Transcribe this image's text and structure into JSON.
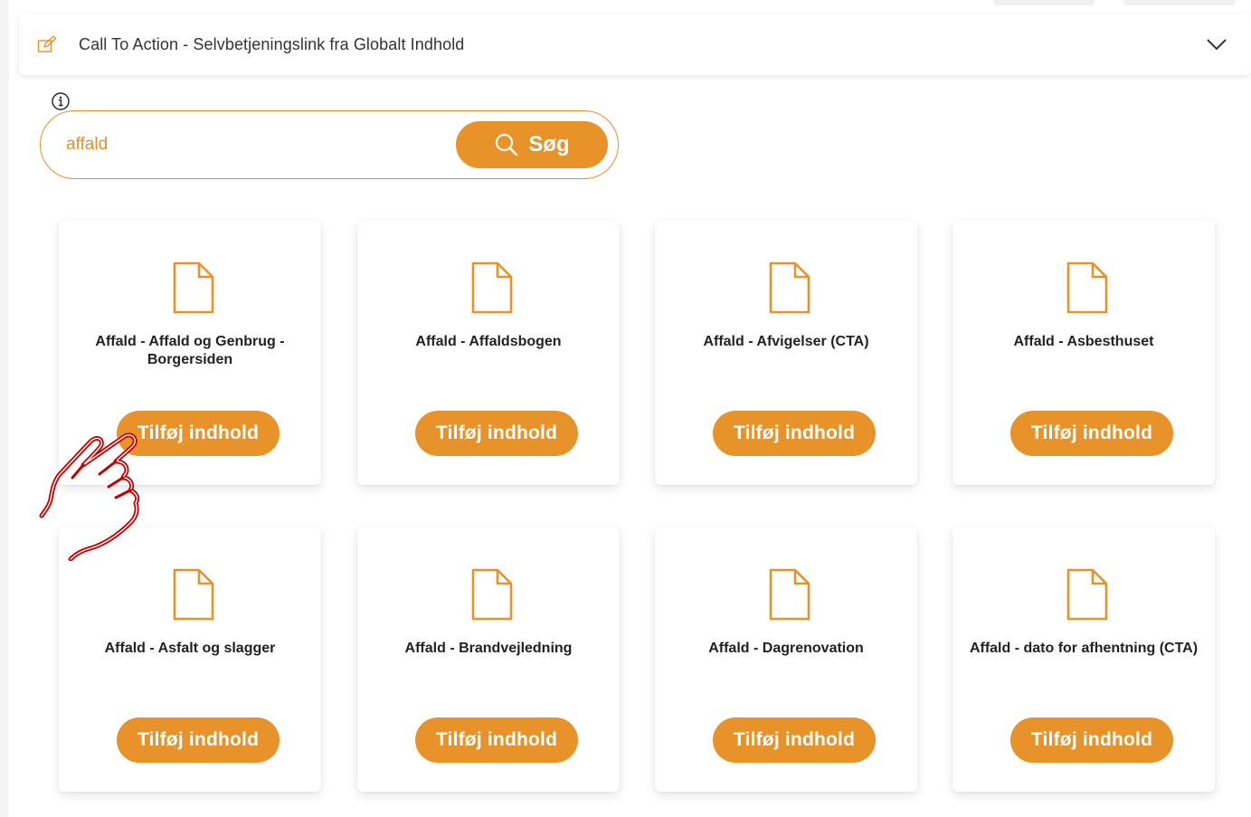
{
  "header": {
    "title": "Call To Action - Selvbetjeningslink fra Globalt Indhold",
    "edit_icon": "edit-icon",
    "toggle_icon": "chevron-down-icon"
  },
  "search": {
    "value": "affald",
    "button_label": "Søg",
    "info_icon": "info-icon"
  },
  "accent_color": "#e8922a",
  "cards": [
    {
      "title": "Affald - Affald og Genbrug - Borgersiden",
      "button": "Tilføj indhold"
    },
    {
      "title": "Affald - Affaldsbogen",
      "button": "Tilføj indhold"
    },
    {
      "title": "Affald - Afvigelser (CTA)",
      "button": "Tilføj indhold"
    },
    {
      "title": "Affald - Asbesthuset",
      "button": "Tilføj indhold"
    },
    {
      "title": "Affald - Asfalt og slagger",
      "button": "Tilføj indhold"
    },
    {
      "title": "Affald - Brandvejledning",
      "button": "Tilføj indhold"
    },
    {
      "title": "Affald - Dagrenovation",
      "button": "Tilføj indhold"
    },
    {
      "title": "Affald - dato for afhentning (CTA)",
      "button": "Tilføj indhold"
    }
  ]
}
